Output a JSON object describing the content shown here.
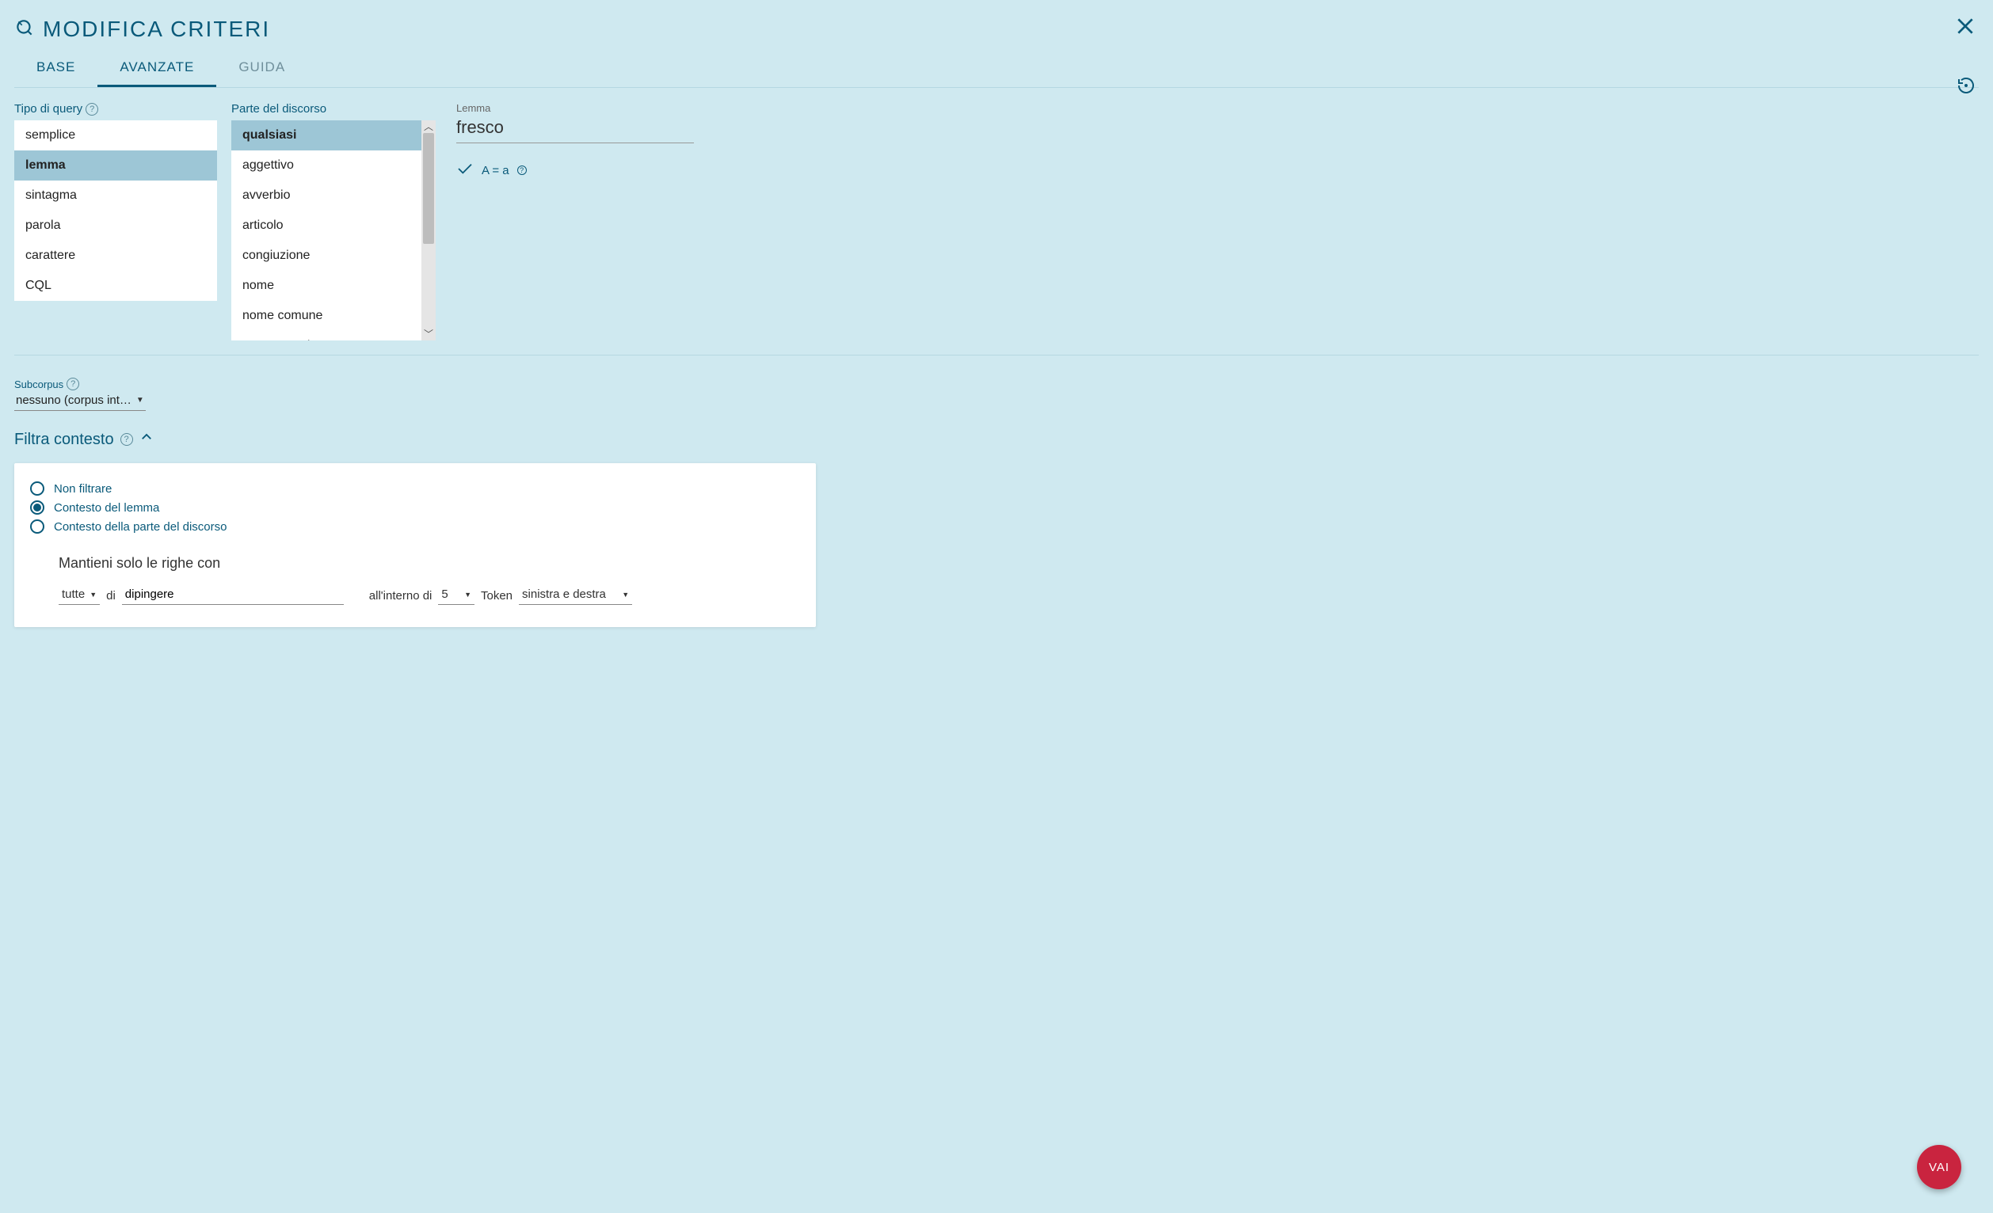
{
  "header": {
    "title": "MODIFICA CRITERI"
  },
  "tabs": {
    "base": "BASE",
    "advanced": "AVANZATE",
    "guide": "GUIDA"
  },
  "query_type": {
    "label": "Tipo di query",
    "items": [
      "semplice",
      "lemma",
      "sintagma",
      "parola",
      "carattere",
      "CQL"
    ],
    "selected": "lemma"
  },
  "pos": {
    "label": "Parte del discorso",
    "items": [
      "qualsiasi",
      "aggettivo",
      "avverbio",
      "articolo",
      "congiuzione",
      "nome",
      "nome comune",
      "nome proprio"
    ],
    "selected": "qualsiasi"
  },
  "lemma_field": {
    "label": "Lemma",
    "value": "fresco",
    "match_case_label": "A = a"
  },
  "subcorpus": {
    "label": "Subcorpus",
    "value": "nessuno (corpus int…"
  },
  "filter": {
    "title": "Filtra contesto",
    "radios": {
      "none": "Non filtrare",
      "lemma": "Contesto del lemma",
      "pos": "Contesto della parte del discorso"
    },
    "keep_label": "Mantieni solo le righe con",
    "quantifier": "tutte",
    "of_word": "di",
    "lemma_value": "dipingere",
    "within_label": "all'interno di",
    "window": "5",
    "token_label": "Token",
    "direction": "sinistra e destra"
  },
  "go_button": "VAI"
}
